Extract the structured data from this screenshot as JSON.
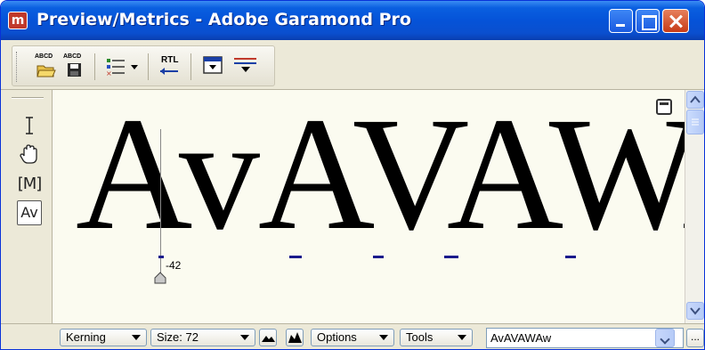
{
  "window": {
    "title": "Preview/Metrics - Adobe Garamond Pro",
    "app_icon_glyph": "m"
  },
  "toolbar": {
    "open_label": "ABCD",
    "save_label": "ABCD",
    "rtl_label": "RTL",
    "icons": [
      "open-sample-icon",
      "save-sample-icon",
      "glyph-options-icon",
      "rtl-toggle-icon",
      "panel-toggle-icon",
      "wrap-toggle-icon"
    ]
  },
  "tools": {
    "icons": [
      "text-cursor-icon",
      "hand-icon",
      "metrics-icon",
      "kerning-icon"
    ],
    "metrics_label": "M",
    "kerning_label": "Av",
    "active": "kerning-icon"
  },
  "canvas": {
    "sample_text": "AvAVAWA",
    "kern_value": "-42"
  },
  "statusbar": {
    "mode_select": "Kerning",
    "size_select": "Size: 72",
    "options_select": "Options",
    "tools_select": "Tools",
    "text_input_value": "AvAVAWAw",
    "more_label": "..."
  },
  "colors": {
    "title_bar": "#0553d8",
    "canvas_bg": "#fbfbf0",
    "kern_mark": "#1a1a8c",
    "close_button": "#c73b16"
  }
}
